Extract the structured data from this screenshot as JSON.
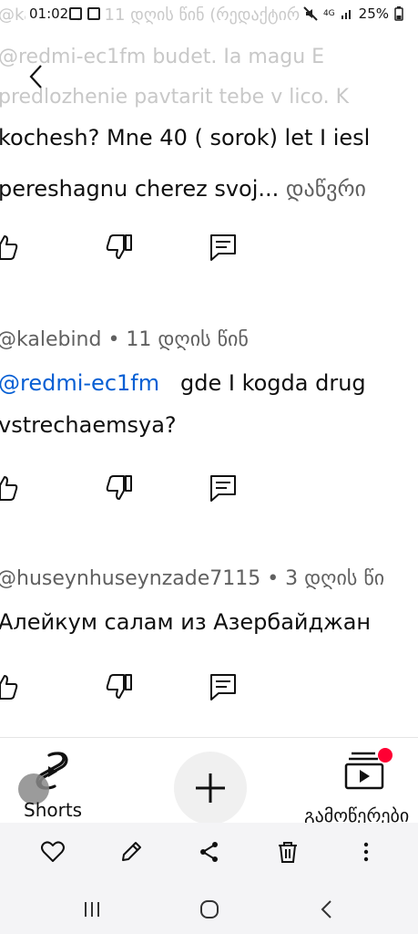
{
  "status_bar": {
    "time": "01:02",
    "network": "4G",
    "battery": "25%",
    "overlay_text": "@kalebind • 11 დღის წინ (რედაქტირ",
    "icons": [
      "image-icon",
      "gallery-icon",
      "mute-icon",
      "signal-icon",
      "battery-icon"
    ]
  },
  "background_ghost": {
    "line1": "@redmi-ec1fm   budet. Ia magu E",
    "line2": "predlozhenie pavtarit tebe v lico. K"
  },
  "comments": [
    {
      "line1": "kochesh? Mne 40 ( sorok) let I iesl",
      "line2": "pereshagnu cherez svoj...",
      "more": "დაწვრი"
    },
    {
      "handle": "@kalebind • 11 დღის წინ",
      "mention": "@redmi-ec1fm",
      "line1_rest": "gde I kogda drug",
      "line2": "vstrechaemsya?"
    },
    {
      "handle": "@huseynhuseynzade7115 • 3 დღის წი",
      "line1": "Алейкум салам из Азербайджан"
    }
  ],
  "bottom_nav": {
    "shorts_label": "Shorts",
    "subscriptions_label": "გამოწერები"
  },
  "colors": {
    "mention": "#065fd4",
    "secondary_text": "#606060",
    "badge": "#ff0033"
  }
}
